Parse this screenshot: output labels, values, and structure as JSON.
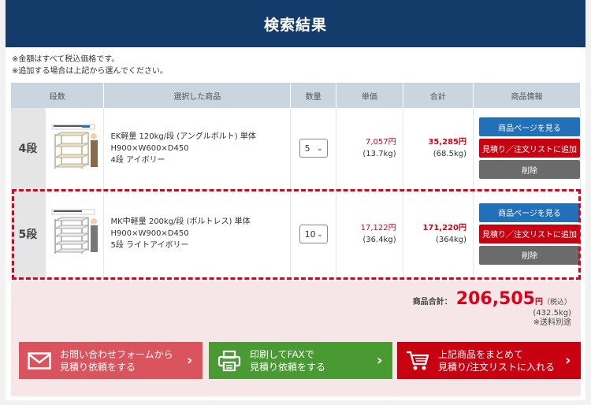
{
  "header": {
    "title": "検索結果"
  },
  "notes": [
    "※金額はすべて税込価格です。",
    "※追加する場合は上記から選んでください。"
  ],
  "table": {
    "headers": [
      "段数",
      "選択した商品",
      "数量",
      "単価",
      "合計",
      "商品情報"
    ],
    "rows": [
      {
        "dan": "4段",
        "name_line1": "EK軽量 120kg/段 (アングルボルト) 単体",
        "name_line2": "H900×W600×D450",
        "name_line3": "4段 アイボリー",
        "qty": "5",
        "unit_price": "7,057円",
        "unit_weight": "(13.7kg)",
        "total_price": "35,285円",
        "total_weight": "(68.5kg)",
        "btn_page": "商品ページを見る",
        "btn_add": "見積り／注文リストに追加",
        "btn_delete": "削除"
      },
      {
        "dan": "5段",
        "name_line1": "MK中軽量 200kg/段 (ボルトレス) 単体",
        "name_line2": "H900×W900×D450",
        "name_line3": "5段 ライトアイボリー",
        "qty": "10",
        "unit_price": "17,122円",
        "unit_weight": "(36.4kg)",
        "total_price": "171,220円",
        "total_weight": "(364kg)",
        "btn_page": "商品ページを見る",
        "btn_add": "見積り／注文リストに追加",
        "btn_delete": "削除"
      }
    ]
  },
  "summary": {
    "label": "商品合計：",
    "amount": "206,505",
    "unit": "円",
    "tax": "（税込）",
    "weight": "(432.5kg)",
    "shipping": "※送料別途"
  },
  "cta": {
    "form": {
      "line1": "お問い合わせフォームから",
      "line2": "見積り依頼をする",
      "color": "#d9545c"
    },
    "fax": {
      "line1": "印刷してFAXで",
      "line2": "見積り依頼をする",
      "color": "#4a9a33"
    },
    "list": {
      "line1": "上記商品をまとめて",
      "line2": "見積り/注文リストに入れる",
      "color": "#c8000f"
    }
  },
  "colors": {
    "header": "#143c6b",
    "accent": "#e00016",
    "blue": "#2170b8"
  }
}
